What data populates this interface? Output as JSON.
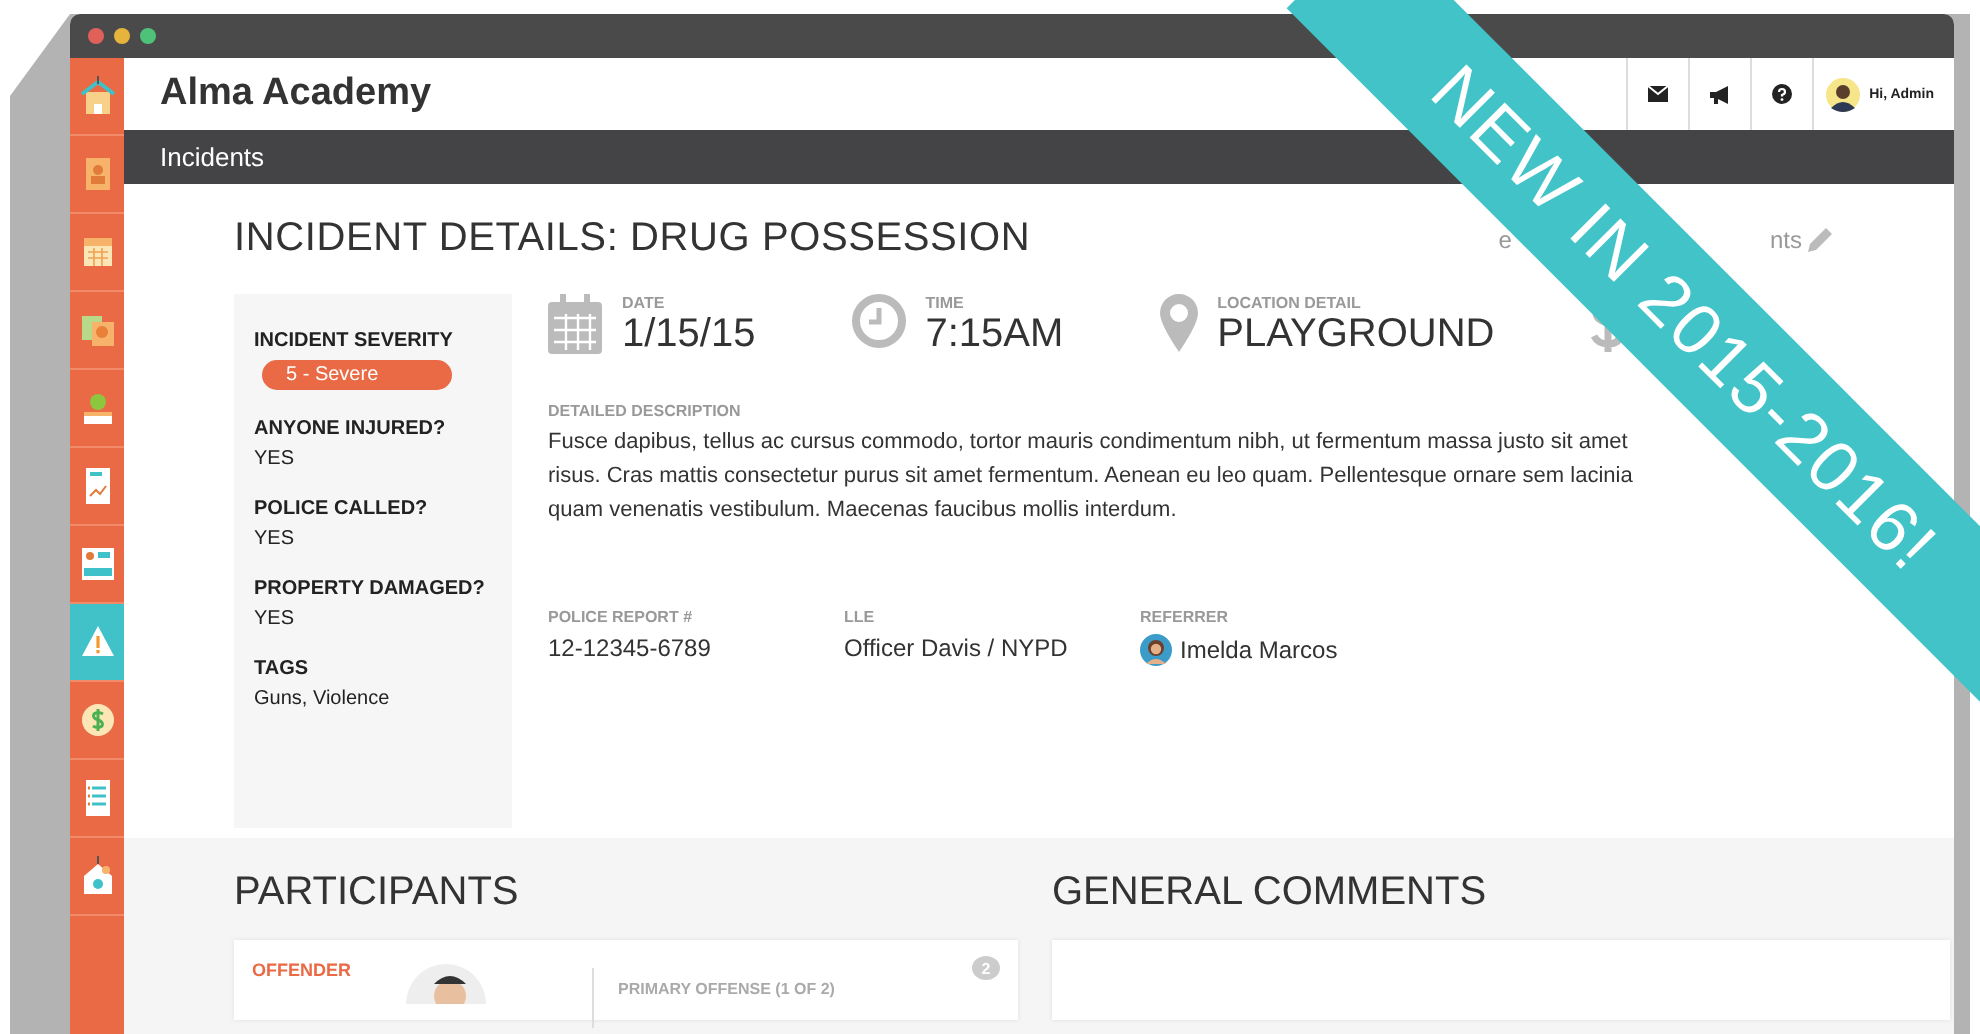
{
  "window": {
    "controls": [
      {
        "color": "#e0605a"
      },
      {
        "color": "#e6b43c"
      },
      {
        "color": "#4fc27a"
      }
    ]
  },
  "sidebar": {
    "items": [
      {
        "selected": false
      },
      {
        "selected": false
      },
      {
        "selected": false
      },
      {
        "selected": false
      },
      {
        "selected": false
      },
      {
        "selected": false
      },
      {
        "selected": false
      },
      {
        "selected": true
      },
      {
        "selected": false
      },
      {
        "selected": false
      },
      {
        "selected": false
      }
    ]
  },
  "header": {
    "title": "Alma Academy",
    "user": "Hi, Admin"
  },
  "nav": {
    "title": "Incidents"
  },
  "ribbon": "NEW IN 2015-2016!",
  "incident": {
    "title": "INCIDENT DETAILS: DRUG POSSESSION",
    "action_start": "e",
    "action_end": "nts",
    "summary": [
      {
        "label": "INCIDENT SEVERITY",
        "value": "5 - Severe",
        "kind": "badge"
      },
      {
        "label": "ANYONE INJURED?",
        "value": "YES",
        "kind": "text"
      },
      {
        "label": "POLICE CALLED?",
        "value": "YES",
        "kind": "text"
      },
      {
        "label": "PROPERTY DAMAGED?",
        "value": "YES",
        "kind": "text"
      },
      {
        "label": "TAGS",
        "value": "Guns, Violence",
        "kind": "text"
      }
    ],
    "stats": [
      {
        "kind": "date",
        "label": "DATE",
        "value": "1/15/15"
      },
      {
        "kind": "time",
        "label": "TIME",
        "value": "7:15AM"
      },
      {
        "kind": "location",
        "label": "LOCATION DETAIL",
        "value": "PLAYGROUND"
      },
      {
        "kind": "cost"
      }
    ],
    "description_label": "DETAILED DESCRIPTION",
    "description": "Fusce dapibus, tellus ac cursus commodo, tortor mauris condimentum nibh, ut fermentum massa justo sit amet risus. Cras mattis consectetur purus sit amet fermentum. Aenean eu leo quam. Pellentesque ornare sem lacinia quam venenatis vestibulum. Maecenas faucibus mollis interdum.",
    "details": [
      {
        "label": "POLICE REPORT #",
        "value": "12-12345-6789",
        "avatar": false
      },
      {
        "label": "LLE",
        "value": "Officer Davis / NYPD",
        "avatar": false
      },
      {
        "label": "REFERRER",
        "value": "Imelda Marcos",
        "avatar": true
      }
    ]
  },
  "participants": {
    "title": "PARTICIPANTS",
    "role": "OFFENDER",
    "offense": "PRIMARY OFFENSE (1 OF 2)",
    "comments": "2"
  },
  "comments": {
    "title": "GENERAL COMMENTS"
  }
}
